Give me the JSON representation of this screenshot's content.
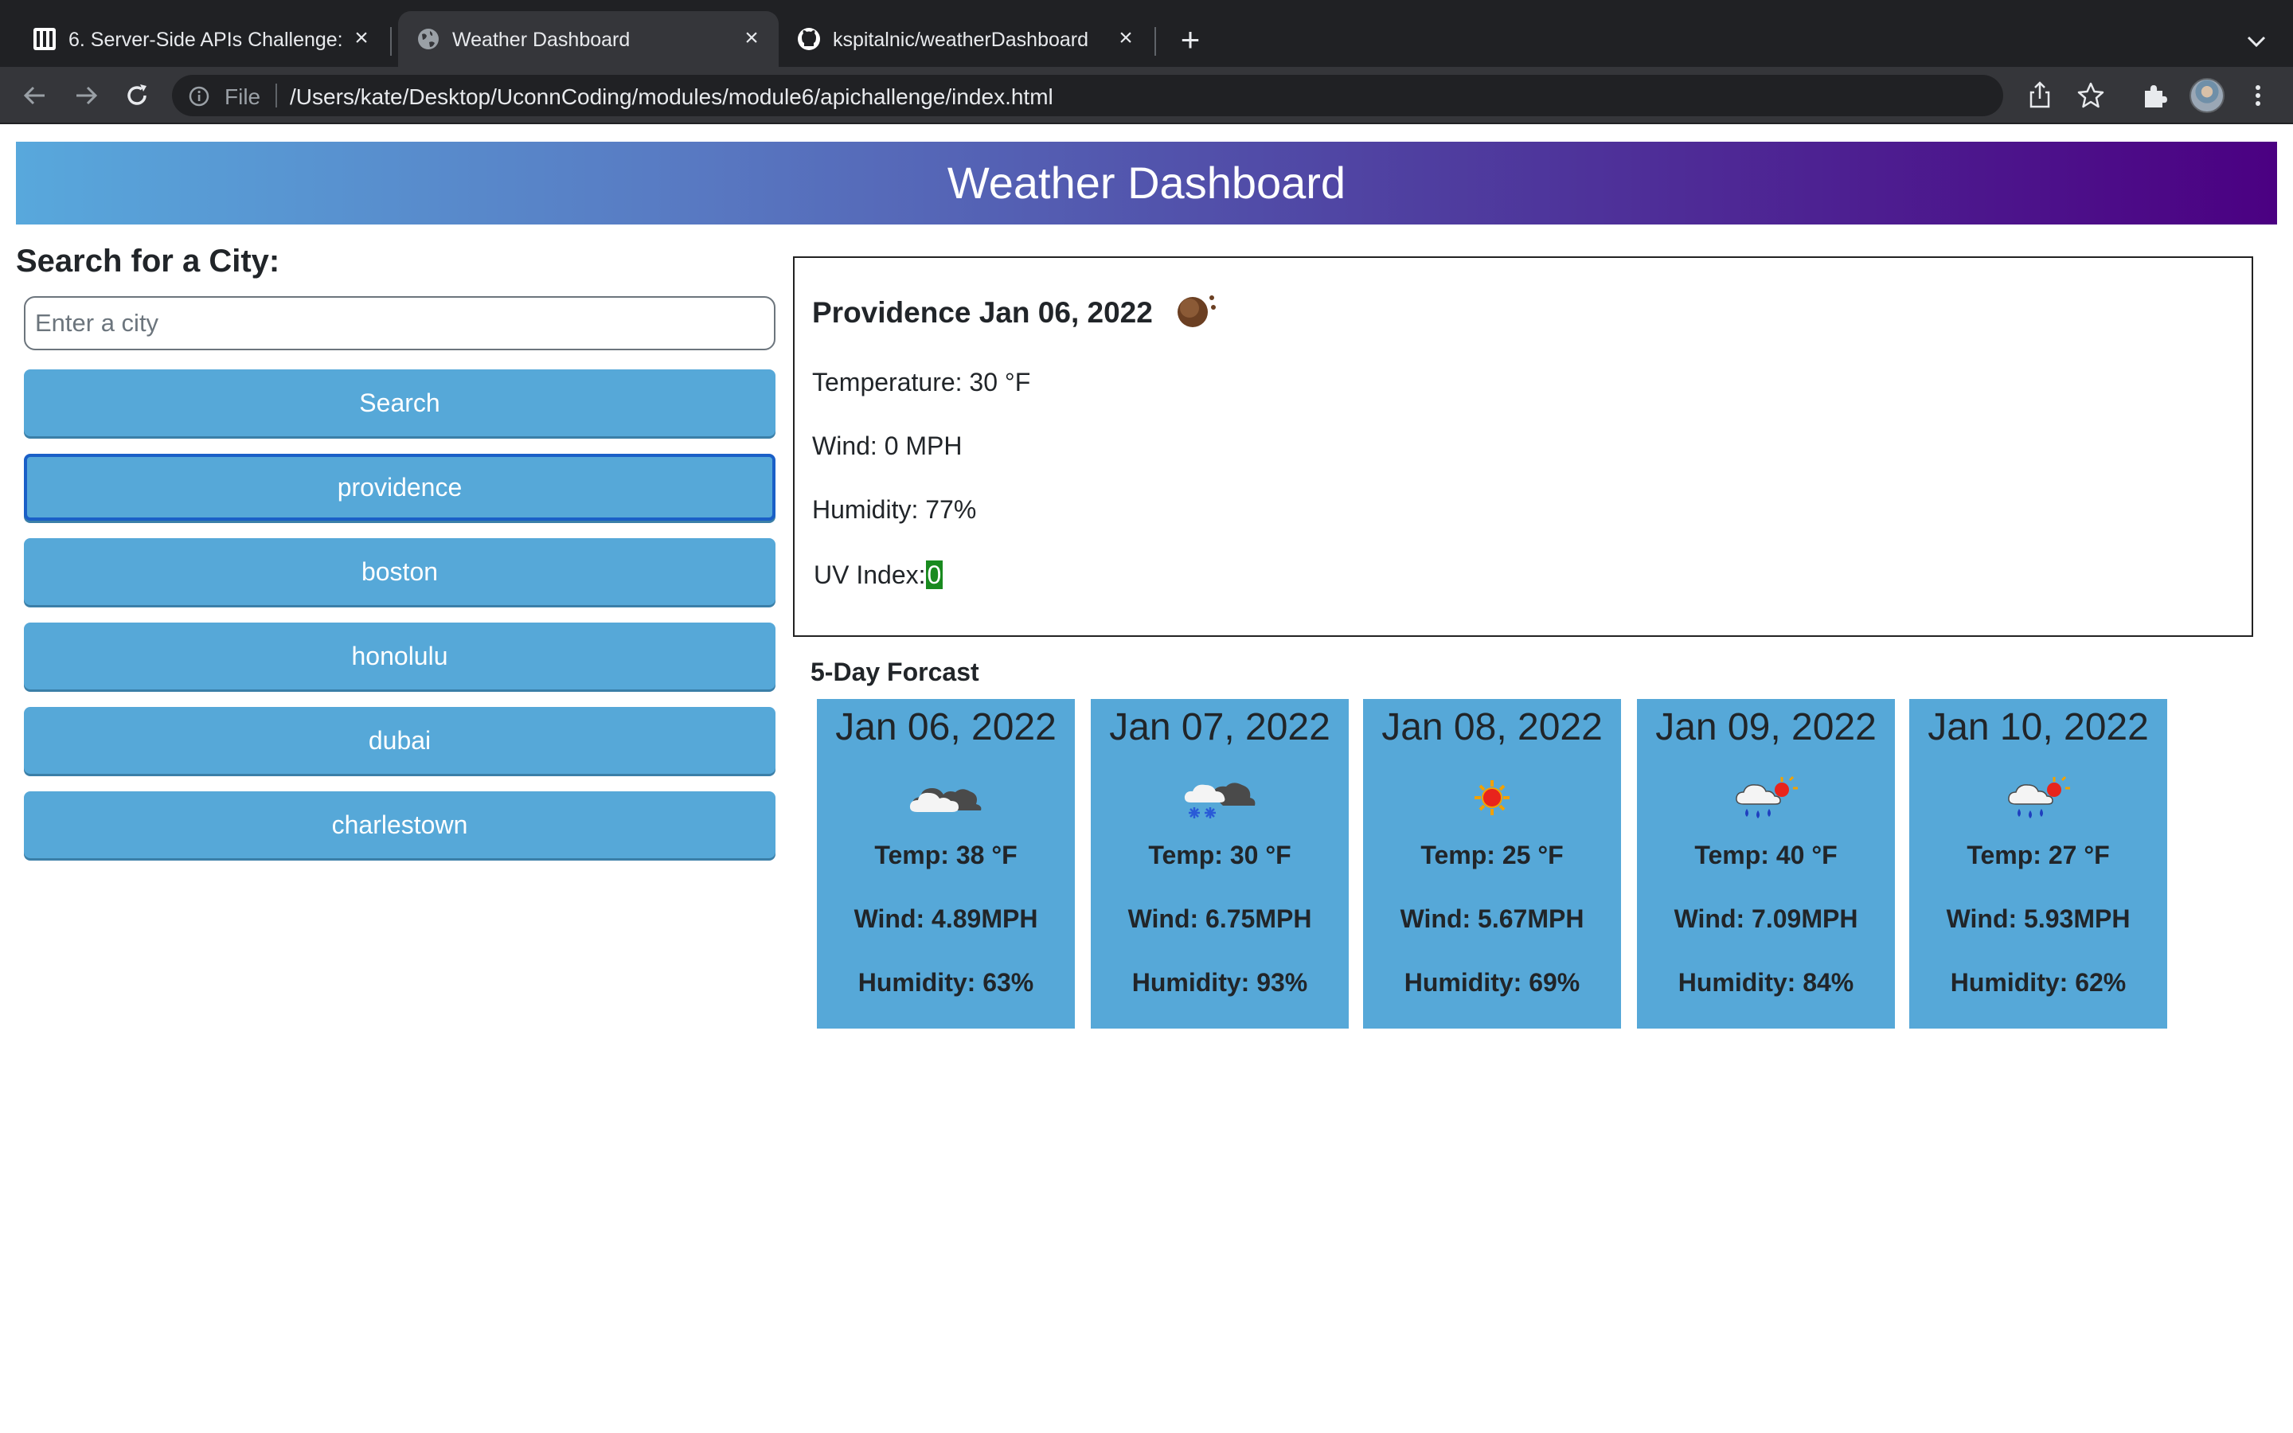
{
  "browser": {
    "tabs": [
      {
        "title": "6. Server-Side APIs Challenge: ",
        "favicon": "bootcamp-logo-icon",
        "active": false
      },
      {
        "title": "Weather Dashboard",
        "favicon": "globe-icon",
        "active": true
      },
      {
        "title": "kspitalnic/weatherDashboard",
        "favicon": "github-icon",
        "active": false
      }
    ],
    "scheme_label": "File",
    "url": "/Users/kate/Desktop/UconnCoding/modules/module6/apichallenge/index.html",
    "colors": {
      "tabbar": "#202124",
      "toolbar": "#35363a",
      "text": "#e8eaed"
    }
  },
  "page": {
    "banner_title": "Weather Dashboard",
    "search": {
      "heading": "Search for a City:",
      "placeholder": "Enter a city",
      "value": "",
      "button_label": "Search"
    },
    "history": [
      "providence",
      "boston",
      "honolulu",
      "dubai",
      "charlestown"
    ],
    "current": {
      "title": "Providence Jan 06, 2022",
      "icon": "moon-night-icon",
      "temperature": "Temperature: 30 °F",
      "wind": "Wind: 0 MPH",
      "humidity": "Humidity: 77%",
      "uv_label": "UV Index:",
      "uv_value": "0",
      "uv_color": "#198a1f"
    },
    "forecast_heading": "5-Day Forcast",
    "forecast": [
      {
        "date": "Jan 06, 2022",
        "icon": "cloud-icon",
        "temp": "Temp: 38 °F",
        "wind": "Wind: 4.89MPH",
        "humidity": "Humidity: 63%"
      },
      {
        "date": "Jan 07, 2022",
        "icon": "snow-cloud-icon",
        "temp": "Temp: 30 °F",
        "wind": "Wind: 6.75MPH",
        "humidity": "Humidity: 93%"
      },
      {
        "date": "Jan 08, 2022",
        "icon": "sun-icon",
        "temp": "Temp: 25 °F",
        "wind": "Wind: 5.67MPH",
        "humidity": "Humidity: 69%"
      },
      {
        "date": "Jan 09, 2022",
        "icon": "rain-sun-cloud-icon",
        "temp": "Temp: 40 °F",
        "wind": "Wind: 7.09MPH",
        "humidity": "Humidity: 84%"
      },
      {
        "date": "Jan 10, 2022",
        "icon": "rain-sun-cloud-icon",
        "temp": "Temp: 27 °F",
        "wind": "Wind: 5.93MPH",
        "humidity": "Humidity: 62%"
      }
    ],
    "colors": {
      "accent": "#56a8d8",
      "banner_start": "#58a8dc",
      "banner_end": "#4b0082"
    }
  }
}
